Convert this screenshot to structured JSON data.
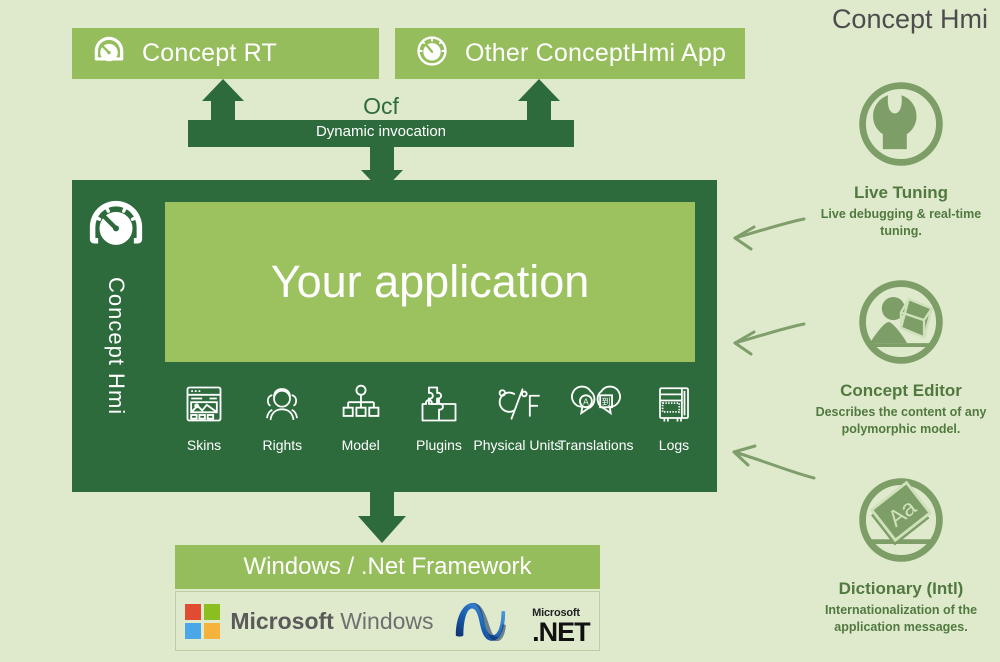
{
  "page": {
    "title": "Concept Hmi",
    "background_color": "#dfeacd",
    "accent_light": "#96bd5c",
    "accent_mid": "#9cc25f",
    "accent_dark": "#2d6b3c",
    "side_text_color": "#51793f"
  },
  "top_boxes": [
    {
      "label": "Concept RT",
      "icon": "gauge-icon"
    },
    {
      "label": "Other ConceptHmi App",
      "icon": "gauge-icon"
    }
  ],
  "connector": {
    "title": "Ocf",
    "subtitle": "Dynamic invocation"
  },
  "framework": {
    "rail_label": "Concept Hmi",
    "rail_icon": "gauge-icon",
    "app_label": "Your application",
    "features": [
      {
        "label": "Skins",
        "icon": "skins-icon"
      },
      {
        "label": "Rights",
        "icon": "rights-icon"
      },
      {
        "label": "Model",
        "icon": "model-icon"
      },
      {
        "label": "Plugins",
        "icon": "plugins-icon"
      },
      {
        "label": "Physical Units",
        "icon": "physical-units-icon"
      },
      {
        "label": "Translations",
        "icon": "translations-icon"
      },
      {
        "label": "Logs",
        "icon": "logs-icon"
      }
    ]
  },
  "platform": {
    "title": "Windows / .Net Framework",
    "windows_logo": {
      "brand": "Microsoft",
      "product": "Windows",
      "square_colors": [
        "#e04b31",
        "#8cbe22",
        "#4aa7e8",
        "#f5b33c"
      ]
    },
    "dotnet_logo": {
      "superscript": "Microsoft",
      "word": ".NET"
    }
  },
  "tools": [
    {
      "title": "Live Tuning",
      "description": "Live debugging & real-time tuning.",
      "icon": "wrench-circle-icon"
    },
    {
      "title": "Concept Editor",
      "description": "Describes the content of any polymorphic model.",
      "icon": "landscape-circle-icon"
    },
    {
      "title": "Dictionary (Intl)",
      "description": "Internationalization of the application messages.",
      "icon": "aa-card-circle-icon"
    }
  ]
}
